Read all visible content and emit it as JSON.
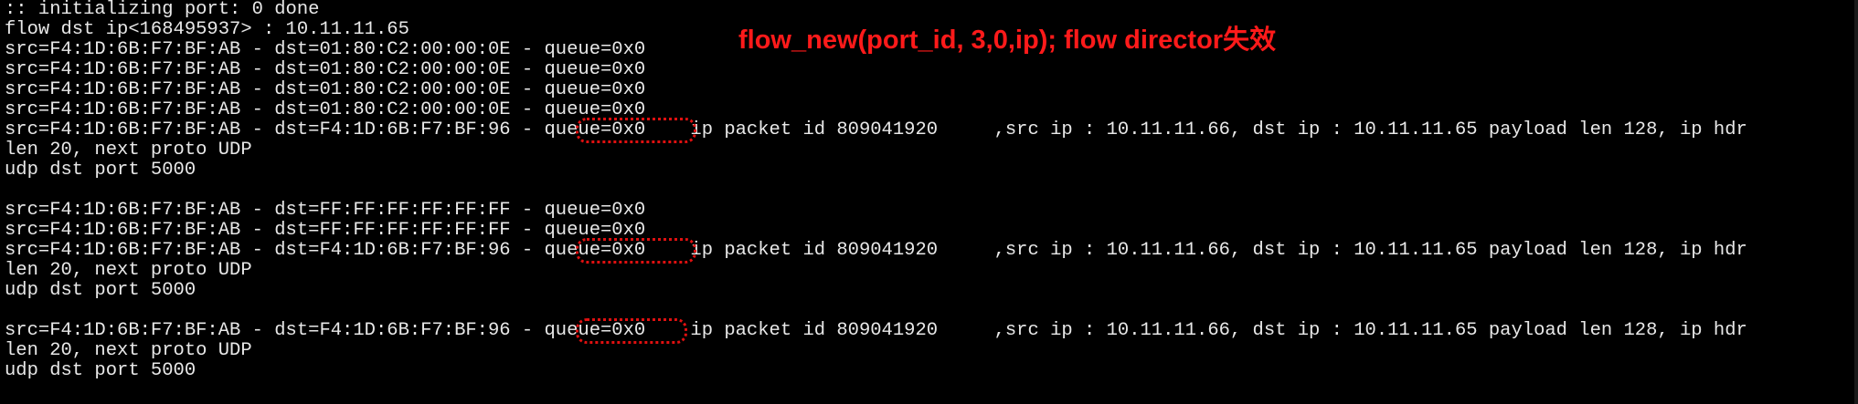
{
  "terminal": {
    "lines": [
      ":: initializing port: 0 done",
      "flow dst ip<168495937> : 10.11.11.65",
      "src=F4:1D:6B:F7:BF:AB - dst=01:80:C2:00:00:0E - queue=0x0",
      "src=F4:1D:6B:F7:BF:AB - dst=01:80:C2:00:00:0E - queue=0x0",
      "src=F4:1D:6B:F7:BF:AB - dst=01:80:C2:00:00:0E - queue=0x0",
      "src=F4:1D:6B:F7:BF:AB - dst=01:80:C2:00:00:0E - queue=0x0",
      "src=F4:1D:6B:F7:BF:AB - dst=F4:1D:6B:F7:BF:96 - queue=0x0    ip packet id 809041920     ,src ip : 10.11.11.66, dst ip : 10.11.11.65 payload len 128, ip hdr",
      "len 20, next proto UDP",
      "udp dst port 5000",
      "",
      "src=F4:1D:6B:F7:BF:AB - dst=FF:FF:FF:FF:FF:FF - queue=0x0",
      "src=F4:1D:6B:F7:BF:AB - dst=FF:FF:FF:FF:FF:FF - queue=0x0",
      "src=F4:1D:6B:F7:BF:AB - dst=F4:1D:6B:F7:BF:96 - queue=0x0    ip packet id 809041920     ,src ip : 10.11.11.66, dst ip : 10.11.11.65 payload len 128, ip hdr",
      "len 20, next proto UDP",
      "udp dst port 5000",
      "",
      "src=F4:1D:6B:F7:BF:AB - dst=F4:1D:6B:F7:BF:96 - queue=0x0    ip packet id 809041920     ,src ip : 10.11.11.66, dst ip : 10.11.11.65 payload len 128, ip hdr",
      "len 20, next proto UDP",
      "udp dst port 5000"
    ]
  },
  "annotation": {
    "text": "flow_new(port_id, 3,0,ip); flow director失效"
  },
  "colors": {
    "background": "#000000",
    "text": "#e8e8e8",
    "annotation": "#ff1a1a",
    "highlight_box": "#e01010"
  }
}
